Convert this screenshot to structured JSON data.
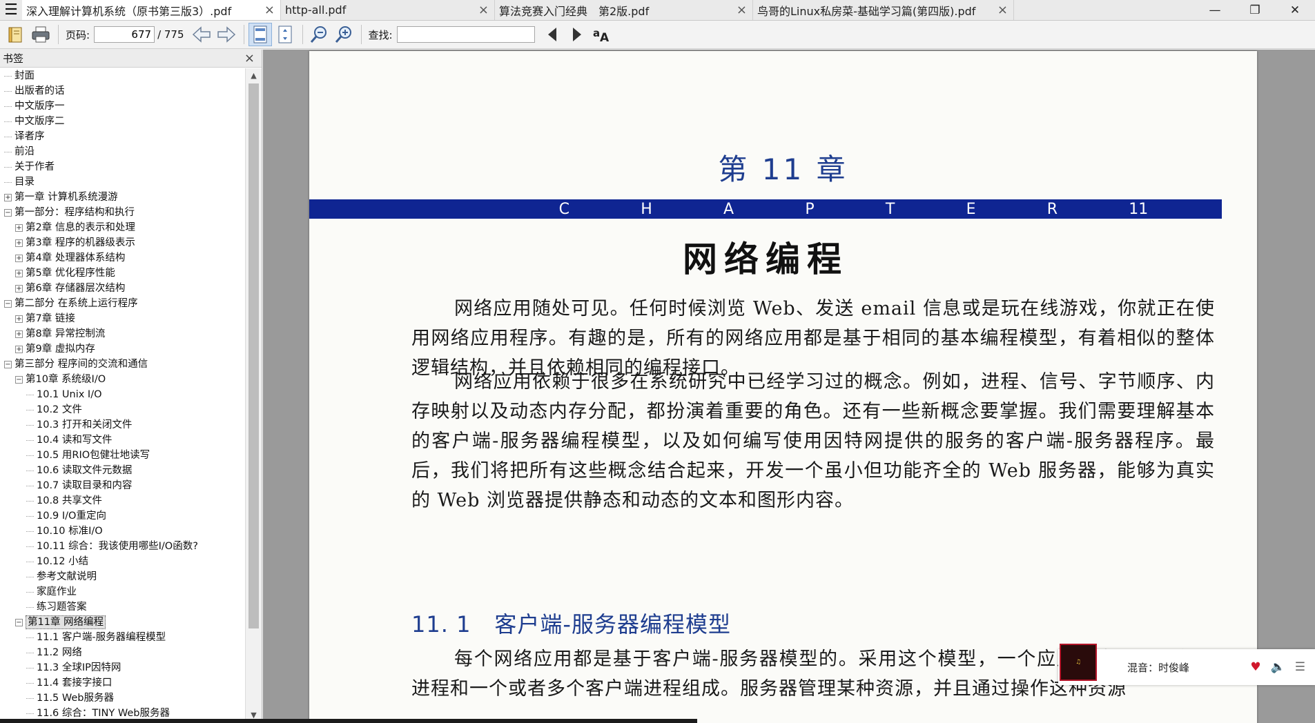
{
  "tabs": [
    {
      "title": "深入理解计算机系统（原书第三版3）.pdf",
      "active": true
    },
    {
      "title": "http-all.pdf",
      "active": false
    },
    {
      "title": "算法竞赛入门经典　第2版.pdf",
      "active": false
    },
    {
      "title": "鸟哥的Linux私房菜-基础学习篇(第四版).pdf",
      "active": false
    }
  ],
  "icons": {
    "menu": "hamburger-icon",
    "close": "×",
    "minimize": "—",
    "restore": "❐",
    "window_close": "✕"
  },
  "toolbar": {
    "page_label": "页码:",
    "page_value": "677",
    "page_total": "/ 775",
    "find_label": "查找:",
    "find_value": ""
  },
  "sidebar": {
    "title": "书签",
    "items": [
      {
        "label": "封面",
        "level": 0,
        "toggle": ""
      },
      {
        "label": "出版者的话",
        "level": 0,
        "toggle": ""
      },
      {
        "label": "中文版序一",
        "level": 0,
        "toggle": ""
      },
      {
        "label": "中文版序二",
        "level": 0,
        "toggle": ""
      },
      {
        "label": "译者序",
        "level": 0,
        "toggle": ""
      },
      {
        "label": "前沿",
        "level": 0,
        "toggle": ""
      },
      {
        "label": "关于作者",
        "level": 0,
        "toggle": ""
      },
      {
        "label": "目录",
        "level": 0,
        "toggle": ""
      },
      {
        "label": "第一章 计算机系统漫游",
        "level": 0,
        "toggle": "+"
      },
      {
        "label": "第一部分：程序结构和执行",
        "level": 0,
        "toggle": "−"
      },
      {
        "label": "第2章 信息的表示和处理",
        "level": 1,
        "toggle": "+"
      },
      {
        "label": "第3章 程序的机器级表示",
        "level": 1,
        "toggle": "+"
      },
      {
        "label": "第4章 处理器体系结构",
        "level": 1,
        "toggle": "+"
      },
      {
        "label": "第5章 优化程序性能",
        "level": 1,
        "toggle": "+"
      },
      {
        "label": "第6章 存储器层次结构",
        "level": 1,
        "toggle": "+"
      },
      {
        "label": "第二部分 在系统上运行程序",
        "level": 0,
        "toggle": "−"
      },
      {
        "label": "第7章 链接",
        "level": 1,
        "toggle": "+"
      },
      {
        "label": "第8章 异常控制流",
        "level": 1,
        "toggle": "+"
      },
      {
        "label": "第9章 虚拟内存",
        "level": 1,
        "toggle": "+"
      },
      {
        "label": "第三部分 程序间的交流和通信",
        "level": 0,
        "toggle": "−"
      },
      {
        "label": "第10章 系统级I/O",
        "level": 1,
        "toggle": "−"
      },
      {
        "label": "10.1 Unix I/O",
        "level": 2,
        "toggle": ""
      },
      {
        "label": "10.2 文件",
        "level": 2,
        "toggle": ""
      },
      {
        "label": "10.3 打开和关闭文件",
        "level": 2,
        "toggle": ""
      },
      {
        "label": "10.4 读和写文件",
        "level": 2,
        "toggle": ""
      },
      {
        "label": "10.5 用RIO包健壮地读写",
        "level": 2,
        "toggle": ""
      },
      {
        "label": "10.6 读取文件元数据",
        "level": 2,
        "toggle": ""
      },
      {
        "label": "10.7 读取目录和内容",
        "level": 2,
        "toggle": ""
      },
      {
        "label": "10.8 共享文件",
        "level": 2,
        "toggle": ""
      },
      {
        "label": "10.9 I/O重定向",
        "level": 2,
        "toggle": ""
      },
      {
        "label": "10.10 标准I/O",
        "level": 2,
        "toggle": ""
      },
      {
        "label": "10.11 综合：我该使用哪些I/O函数?",
        "level": 2,
        "toggle": ""
      },
      {
        "label": "10.12 小结",
        "level": 2,
        "toggle": ""
      },
      {
        "label": "参考文献说明",
        "level": 2,
        "toggle": ""
      },
      {
        "label": "家庭作业",
        "level": 2,
        "toggle": ""
      },
      {
        "label": "练习题答案",
        "level": 2,
        "toggle": ""
      },
      {
        "label": "第11章 网络编程",
        "level": 1,
        "toggle": "−",
        "selected": true
      },
      {
        "label": "11.1 客户端-服务器编程模型",
        "level": 2,
        "toggle": ""
      },
      {
        "label": "11.2 网络",
        "level": 2,
        "toggle": ""
      },
      {
        "label": "11.3 全球IP因特网",
        "level": 2,
        "toggle": ""
      },
      {
        "label": "11.4 套接字接口",
        "level": 2,
        "toggle": ""
      },
      {
        "label": "11.5 Web服务器",
        "level": 2,
        "toggle": ""
      },
      {
        "label": "11.6 综合：TINY Web服务器",
        "level": 2,
        "toggle": ""
      }
    ]
  },
  "document": {
    "chapter_number": "第 11 章",
    "chapter_letters": [
      "C",
      "H",
      "A",
      "P",
      "T",
      "E",
      "R",
      "11"
    ],
    "chapter_title": "网络编程",
    "paragraphs": [
      "网络应用随处可见。任何时候浏览 Web、发送 email 信息或是玩在线游戏，你就正在使用网络应用程序。有趣的是，所有的网络应用都是基于相同的基本编程模型，有着相似的整体逻辑结构，并且依赖相同的编程接口。",
      "网络应用依赖于很多在系统研究中已经学习过的概念。例如，进程、信号、字节顺序、内存映射以及动态内存分配，都扮演着重要的角色。还有一些新概念要掌握。我们需要理解基本的客户端-服务器编程模型，以及如何编写使用因特网提供的服务的客户端-服务器程序。最后，我们将把所有这些概念结合起来，开发一个虽小但功能齐全的 Web 服务器，能够为真实的 Web 浏览器提供静态和动态的文本和图形内容。"
    ],
    "section_number": "11. 1",
    "section_title": "客户端-服务器编程模型",
    "last_paragraph": "每个网络应用都是基于客户端-服务器模型的。采用这个模型，一个应用是由一个服务器进程和一个或者多个客户端进程组成。服务器管理某种资源，并且通过操作这种资源"
  },
  "music": {
    "song": "混音：时俊峰"
  }
}
